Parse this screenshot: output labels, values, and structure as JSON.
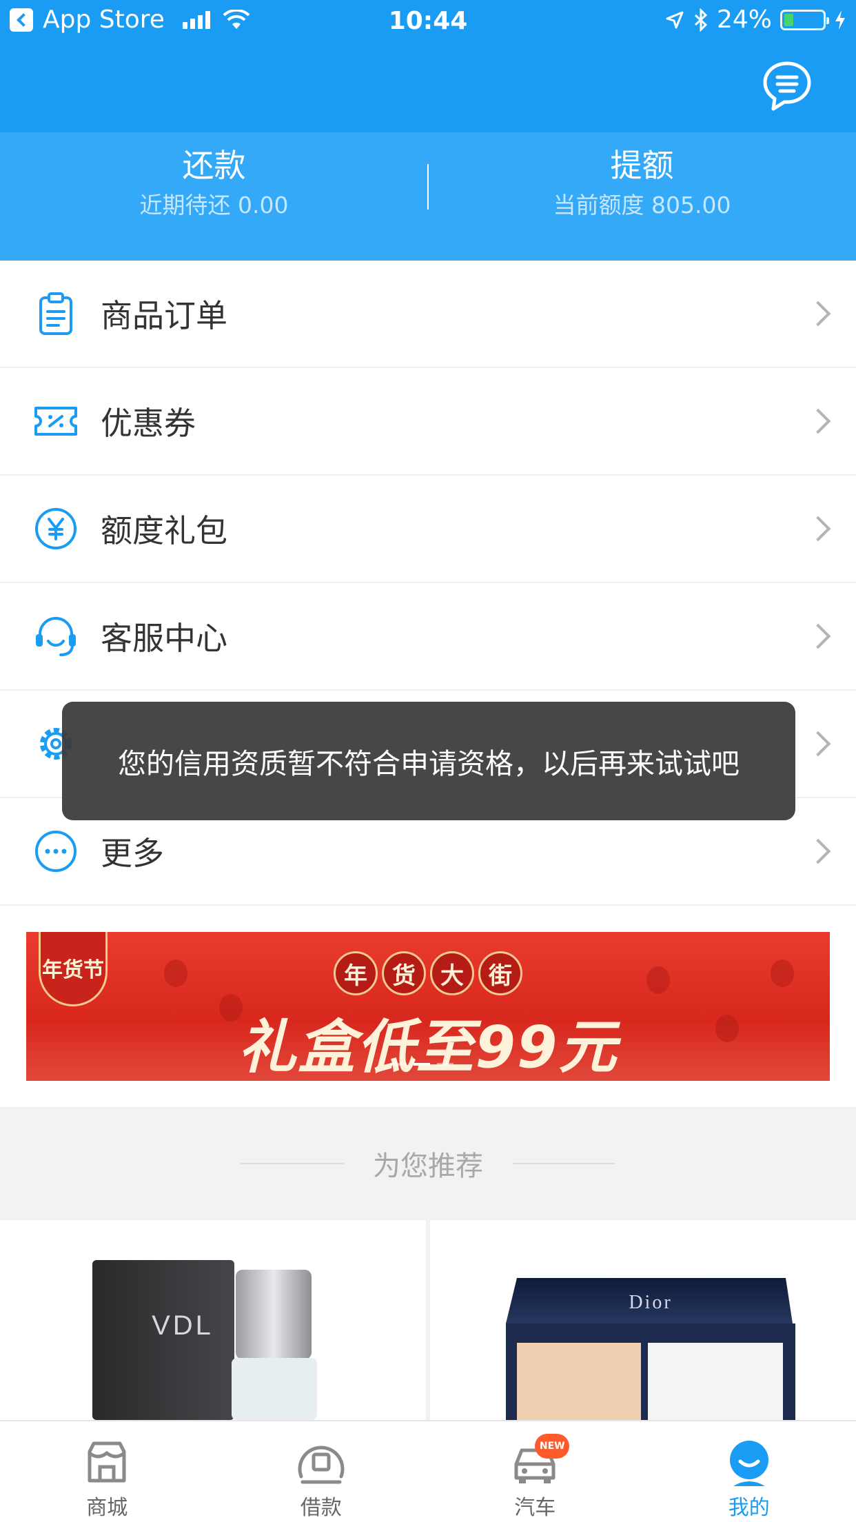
{
  "status_bar": {
    "back_app": "App Store",
    "time": "10:44",
    "battery_percent": "24%",
    "battery_level": 0.24
  },
  "quick_actions": [
    {
      "title": "还款",
      "subtitle": "近期待还 0.00"
    },
    {
      "title": "提额",
      "subtitle": "当前额度 805.00"
    }
  ],
  "menu": {
    "items": [
      {
        "label": "商品订单",
        "icon": "clipboard-icon"
      },
      {
        "label": "优惠券",
        "icon": "coupon-icon"
      },
      {
        "label": "额度礼包",
        "icon": "yuan-icon"
      },
      {
        "label": "客服中心",
        "icon": "headset-icon"
      },
      {
        "label": "",
        "icon": "gear-icon"
      },
      {
        "label": "更多",
        "icon": "more-icon"
      }
    ]
  },
  "toast": {
    "message": "您的信用资质暂不符合申请资格，以后再来试试吧"
  },
  "banner": {
    "ribbon": "年货节",
    "circles": [
      "年",
      "货",
      "大",
      "街"
    ],
    "headline": "礼盒低至99元",
    "page_count": 3,
    "active_page": 1
  },
  "recommend": {
    "title": "为您推荐",
    "products": [
      {
        "brand_text": "VDL"
      },
      {
        "brand_text": "Dior"
      }
    ]
  },
  "tabbar": {
    "tabs": [
      {
        "label": "商城",
        "icon": "store-icon"
      },
      {
        "label": "借款",
        "icon": "loan-icon"
      },
      {
        "label": "汽车",
        "icon": "car-icon",
        "badge": "NEW"
      },
      {
        "label": "我的",
        "icon": "profile-icon",
        "active": true
      }
    ]
  },
  "colors": {
    "primary": "#1a9cf4",
    "toast_bg": "#3c3c3c",
    "banner_red": "#e93b2e"
  }
}
